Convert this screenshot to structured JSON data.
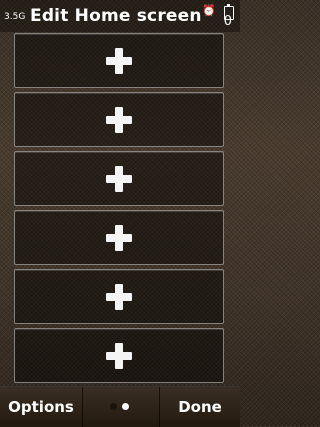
{
  "header": {
    "title": "Edit Home screen",
    "antenna_label": "3.5G",
    "status_counter": "0",
    "alarm_icon": "alarm-clock-icon",
    "battery_icon": "battery-icon"
  },
  "slots": [
    {
      "icon": "add-icon"
    },
    {
      "icon": "add-icon"
    },
    {
      "icon": "add-icon"
    },
    {
      "icon": "add-icon"
    },
    {
      "icon": "add-icon"
    },
    {
      "icon": "add-icon"
    }
  ],
  "softkeys": {
    "left_label": "Options",
    "right_label": "Done",
    "page_indicator": {
      "pages": 2,
      "current": 2
    }
  },
  "colors": {
    "background": "#3a3026",
    "softkey_bar": "#22190f",
    "text": "#ffffff"
  }
}
